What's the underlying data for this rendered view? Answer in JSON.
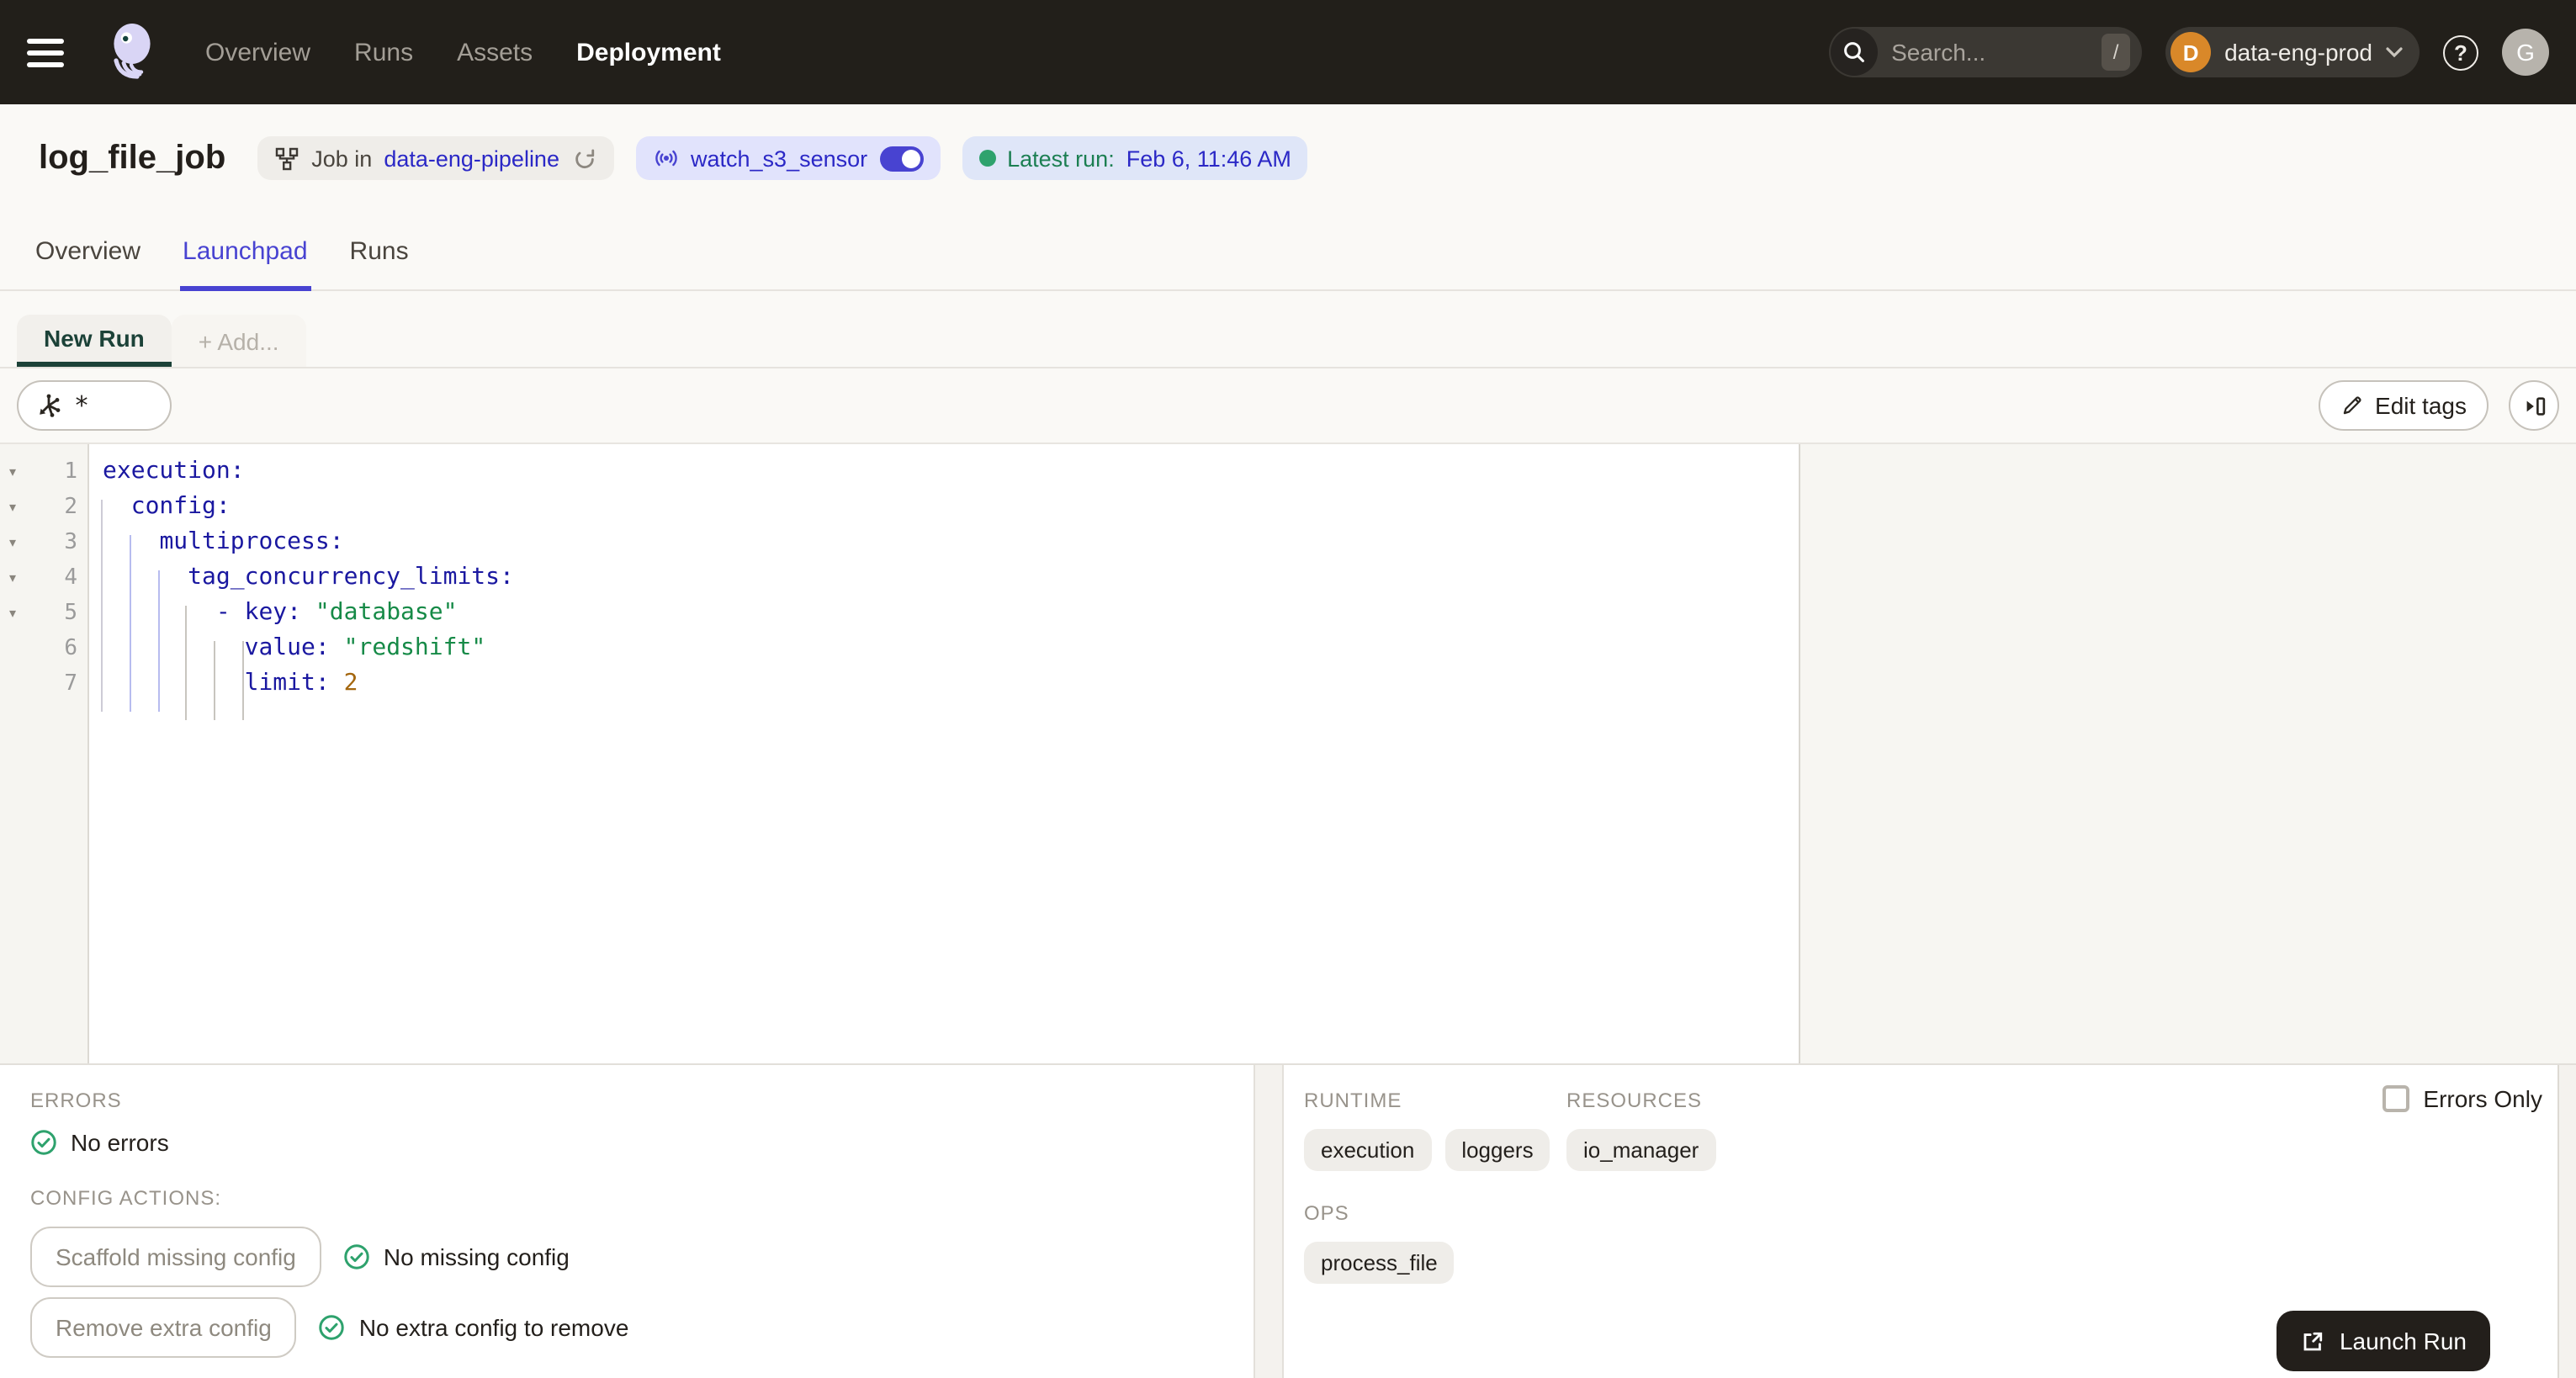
{
  "colors": {
    "nav_bg": "#221F1A",
    "accent": "#4843D1",
    "link": "#2B28C6",
    "green": "#2EA26D",
    "green_text": "#1C7F52",
    "avatar_orange": "#D98829",
    "code_key": "#1A18A0",
    "code_string": "#168A47",
    "code_number": "#A4670F"
  },
  "nav": {
    "items": [
      {
        "label": "Overview",
        "active": false
      },
      {
        "label": "Runs",
        "active": false
      },
      {
        "label": "Assets",
        "active": false
      },
      {
        "label": "Deployment",
        "active": true
      }
    ],
    "search": {
      "placeholder": "Search...",
      "shortcut": "/"
    },
    "deployment": {
      "initial": "D",
      "name": "data-eng-prod"
    },
    "user": {
      "initial": "G"
    },
    "help_glyph": "?"
  },
  "header": {
    "title": "log_file_job",
    "job_badge": {
      "prefix": "Job in",
      "repo": "data-eng-pipeline"
    },
    "sensor_badge": {
      "name": "watch_s3_sensor",
      "enabled": true
    },
    "run_badge": {
      "label": "Latest run:",
      "time": "Feb 6, 11:46 AM"
    }
  },
  "tabs": [
    {
      "label": "Overview",
      "active": false
    },
    {
      "label": "Launchpad",
      "active": true
    },
    {
      "label": "Runs",
      "active": false
    }
  ],
  "launchpad": {
    "session_tab": "New Run",
    "add_tab": "+ Add...",
    "op_selector_value": "*",
    "edit_tags_label": "Edit tags"
  },
  "editor": {
    "lines": [
      {
        "num": 1,
        "fold": true,
        "tokens": [
          [
            "key",
            "execution:"
          ]
        ]
      },
      {
        "num": 2,
        "fold": true,
        "tokens": [
          [
            "ws",
            "  "
          ],
          [
            "key",
            "config:"
          ]
        ]
      },
      {
        "num": 3,
        "fold": true,
        "tokens": [
          [
            "ws",
            "    "
          ],
          [
            "key",
            "multiprocess:"
          ]
        ]
      },
      {
        "num": 4,
        "fold": true,
        "tokens": [
          [
            "ws",
            "      "
          ],
          [
            "key",
            "tag_concurrency_limits:"
          ]
        ]
      },
      {
        "num": 5,
        "fold": true,
        "tokens": [
          [
            "ws",
            "        "
          ],
          [
            "key",
            "- key:"
          ],
          [
            "ws",
            " "
          ],
          [
            "str",
            "\"database\""
          ]
        ]
      },
      {
        "num": 6,
        "fold": false,
        "tokens": [
          [
            "ws",
            "          "
          ],
          [
            "key",
            "value:"
          ],
          [
            "ws",
            " "
          ],
          [
            "str",
            "\"redshift\""
          ]
        ]
      },
      {
        "num": 7,
        "fold": false,
        "tokens": [
          [
            "ws",
            "          "
          ],
          [
            "key",
            "limit:"
          ],
          [
            "ws",
            " "
          ],
          [
            "num",
            "2"
          ]
        ]
      }
    ]
  },
  "bottom": {
    "errors": {
      "heading": "ERRORS",
      "status": "No errors"
    },
    "config_actions": {
      "heading": "CONFIG ACTIONS:",
      "rows": [
        {
          "button": "Scaffold missing config",
          "status": "No missing config"
        },
        {
          "button": "Remove extra config",
          "status": "No extra config to remove"
        }
      ]
    },
    "columns": [
      [
        {
          "heading": "RUNTIME",
          "tags": [
            "execution",
            "loggers"
          ]
        },
        {
          "heading": "OPS",
          "tags": [
            "process_file"
          ]
        }
      ],
      [
        {
          "heading": "RESOURCES",
          "tags": [
            "io_manager"
          ]
        }
      ]
    ],
    "errors_only_label": "Errors Only",
    "launch_button": "Launch Run"
  },
  "icons": {
    "fold_arrow": "▾",
    "chevron_down": "▾"
  }
}
